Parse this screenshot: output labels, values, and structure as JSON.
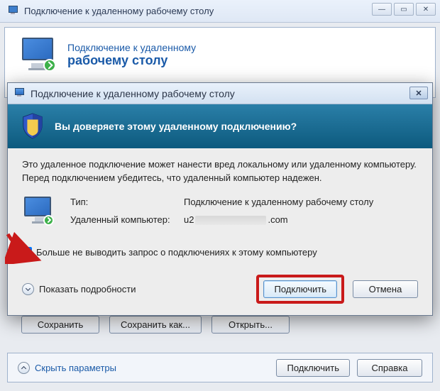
{
  "bg": {
    "title": "Подключение к удаленному рабочему столу",
    "header_line1": "Подключение к удаленному",
    "header_line2": "рабочему столу",
    "buttons": {
      "save": "Сохранить",
      "save_as": "Сохранить как...",
      "open": "Открыть..."
    },
    "footer": {
      "hide": "Скрыть параметры",
      "connect": "Подключить",
      "help": "Справка"
    }
  },
  "dialog": {
    "title": "Подключение к удаленному рабочему столу",
    "ribbon": "Вы доверяете этому удаленному подключению?",
    "warning": "Это удаленное подключение может нанести вред локальному или удаленному компьютеру. Перед подключением убедитесь, что удаленный компьютер надежен.",
    "rows": {
      "type_label": "Тип:",
      "type_value": "Подключение к удаленному рабочему столу",
      "host_label": "Удаленный компьютер:",
      "host_prefix": "u2",
      "host_suffix": ".com"
    },
    "checkbox": "Больше не выводить запрос о подключениях к этому компьютеру",
    "details": "Показать подробности",
    "buttons": {
      "connect": "Подключить",
      "cancel": "Отмена"
    }
  },
  "annotation": {
    "highlight_connect": true,
    "arrow_to_checkbox": true
  }
}
